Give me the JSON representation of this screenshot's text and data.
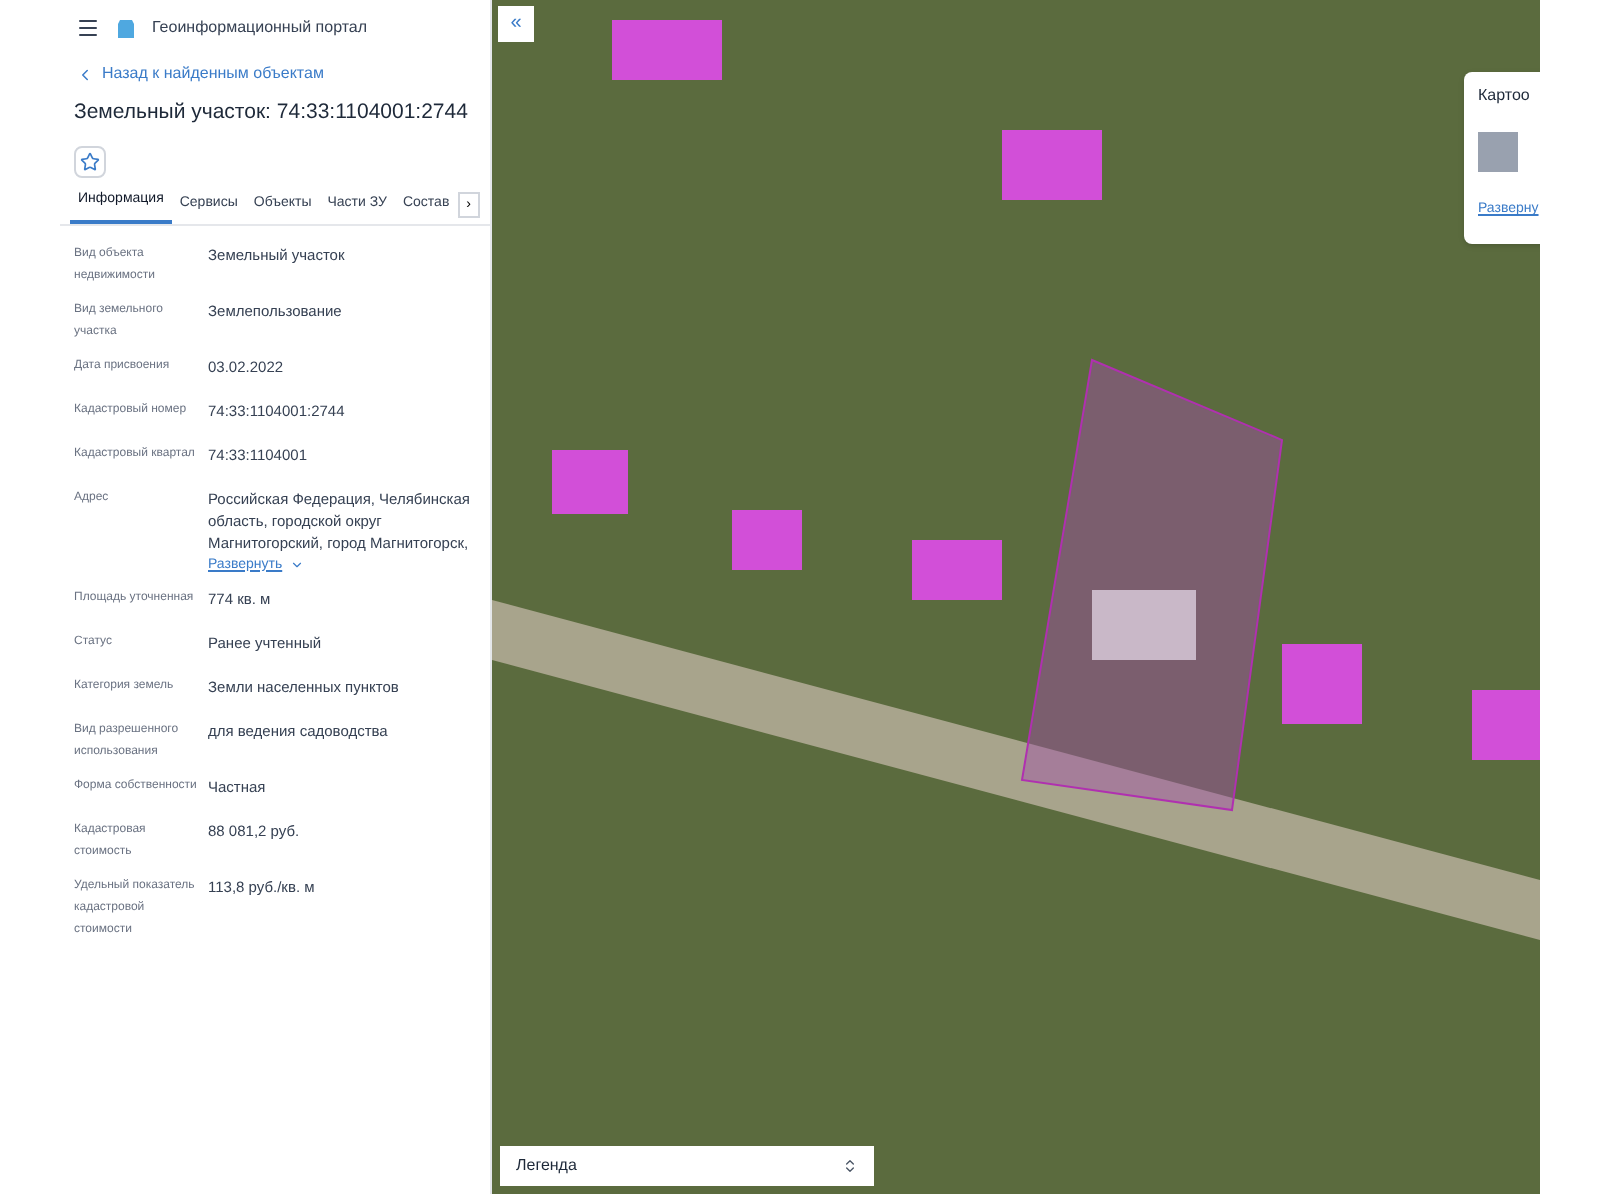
{
  "header": {
    "title": "Геоинформационный портал"
  },
  "back_link": "Назад к найденным объектам",
  "object_title": "Земельный участок: 74:33:1104001:2744",
  "favorite": {
    "on": false
  },
  "tabs": [
    {
      "label": "Информация",
      "selected": true
    },
    {
      "label": "Сервисы",
      "selected": false
    },
    {
      "label": "Объекты",
      "selected": false
    },
    {
      "label": "Части ЗУ",
      "selected": false
    },
    {
      "label": "Состав",
      "selected": false
    }
  ],
  "tabs_more": "›",
  "fields": [
    {
      "label": "Вид объекта недвижимости",
      "value": "Земельный участок"
    },
    {
      "label": "Вид земельного участка",
      "value": "Землепользование"
    },
    {
      "label": "Дата присвоения",
      "value": "03.02.2022"
    },
    {
      "label": "Кадастровый номер",
      "value": "74:33:1104001:2744"
    },
    {
      "label": "Кадастровый квартал",
      "value": "74:33:1104001"
    },
    {
      "label": "Адрес",
      "value": "Российская Федерация, Челябинская область, городской округ Магнитогорский, город Магнитогорск,",
      "expand_link": "Развернуть"
    },
    {
      "label": "Площадь уточненная",
      "value": "774 кв. м"
    },
    {
      "label": "Статус",
      "value": "Ранее учтенный"
    },
    {
      "label": "Категория земель",
      "value": "Земли населенных пунктов"
    },
    {
      "label": "Вид разрешенного использования",
      "value": "для ведения садоводства"
    },
    {
      "label": "Форма собственности",
      "value": "Частная"
    },
    {
      "label": "Кадастровая стоимость",
      "value": "88 081,2 руб."
    },
    {
      "label": "Удельный показатель кадастровой стоимости",
      "value": "113,8 руб./кв. м"
    }
  ],
  "map": {
    "collapse_button": "«",
    "card": {
      "title": "Картоо",
      "link": "Разверну"
    },
    "legend": {
      "label": "Легенда"
    }
  }
}
